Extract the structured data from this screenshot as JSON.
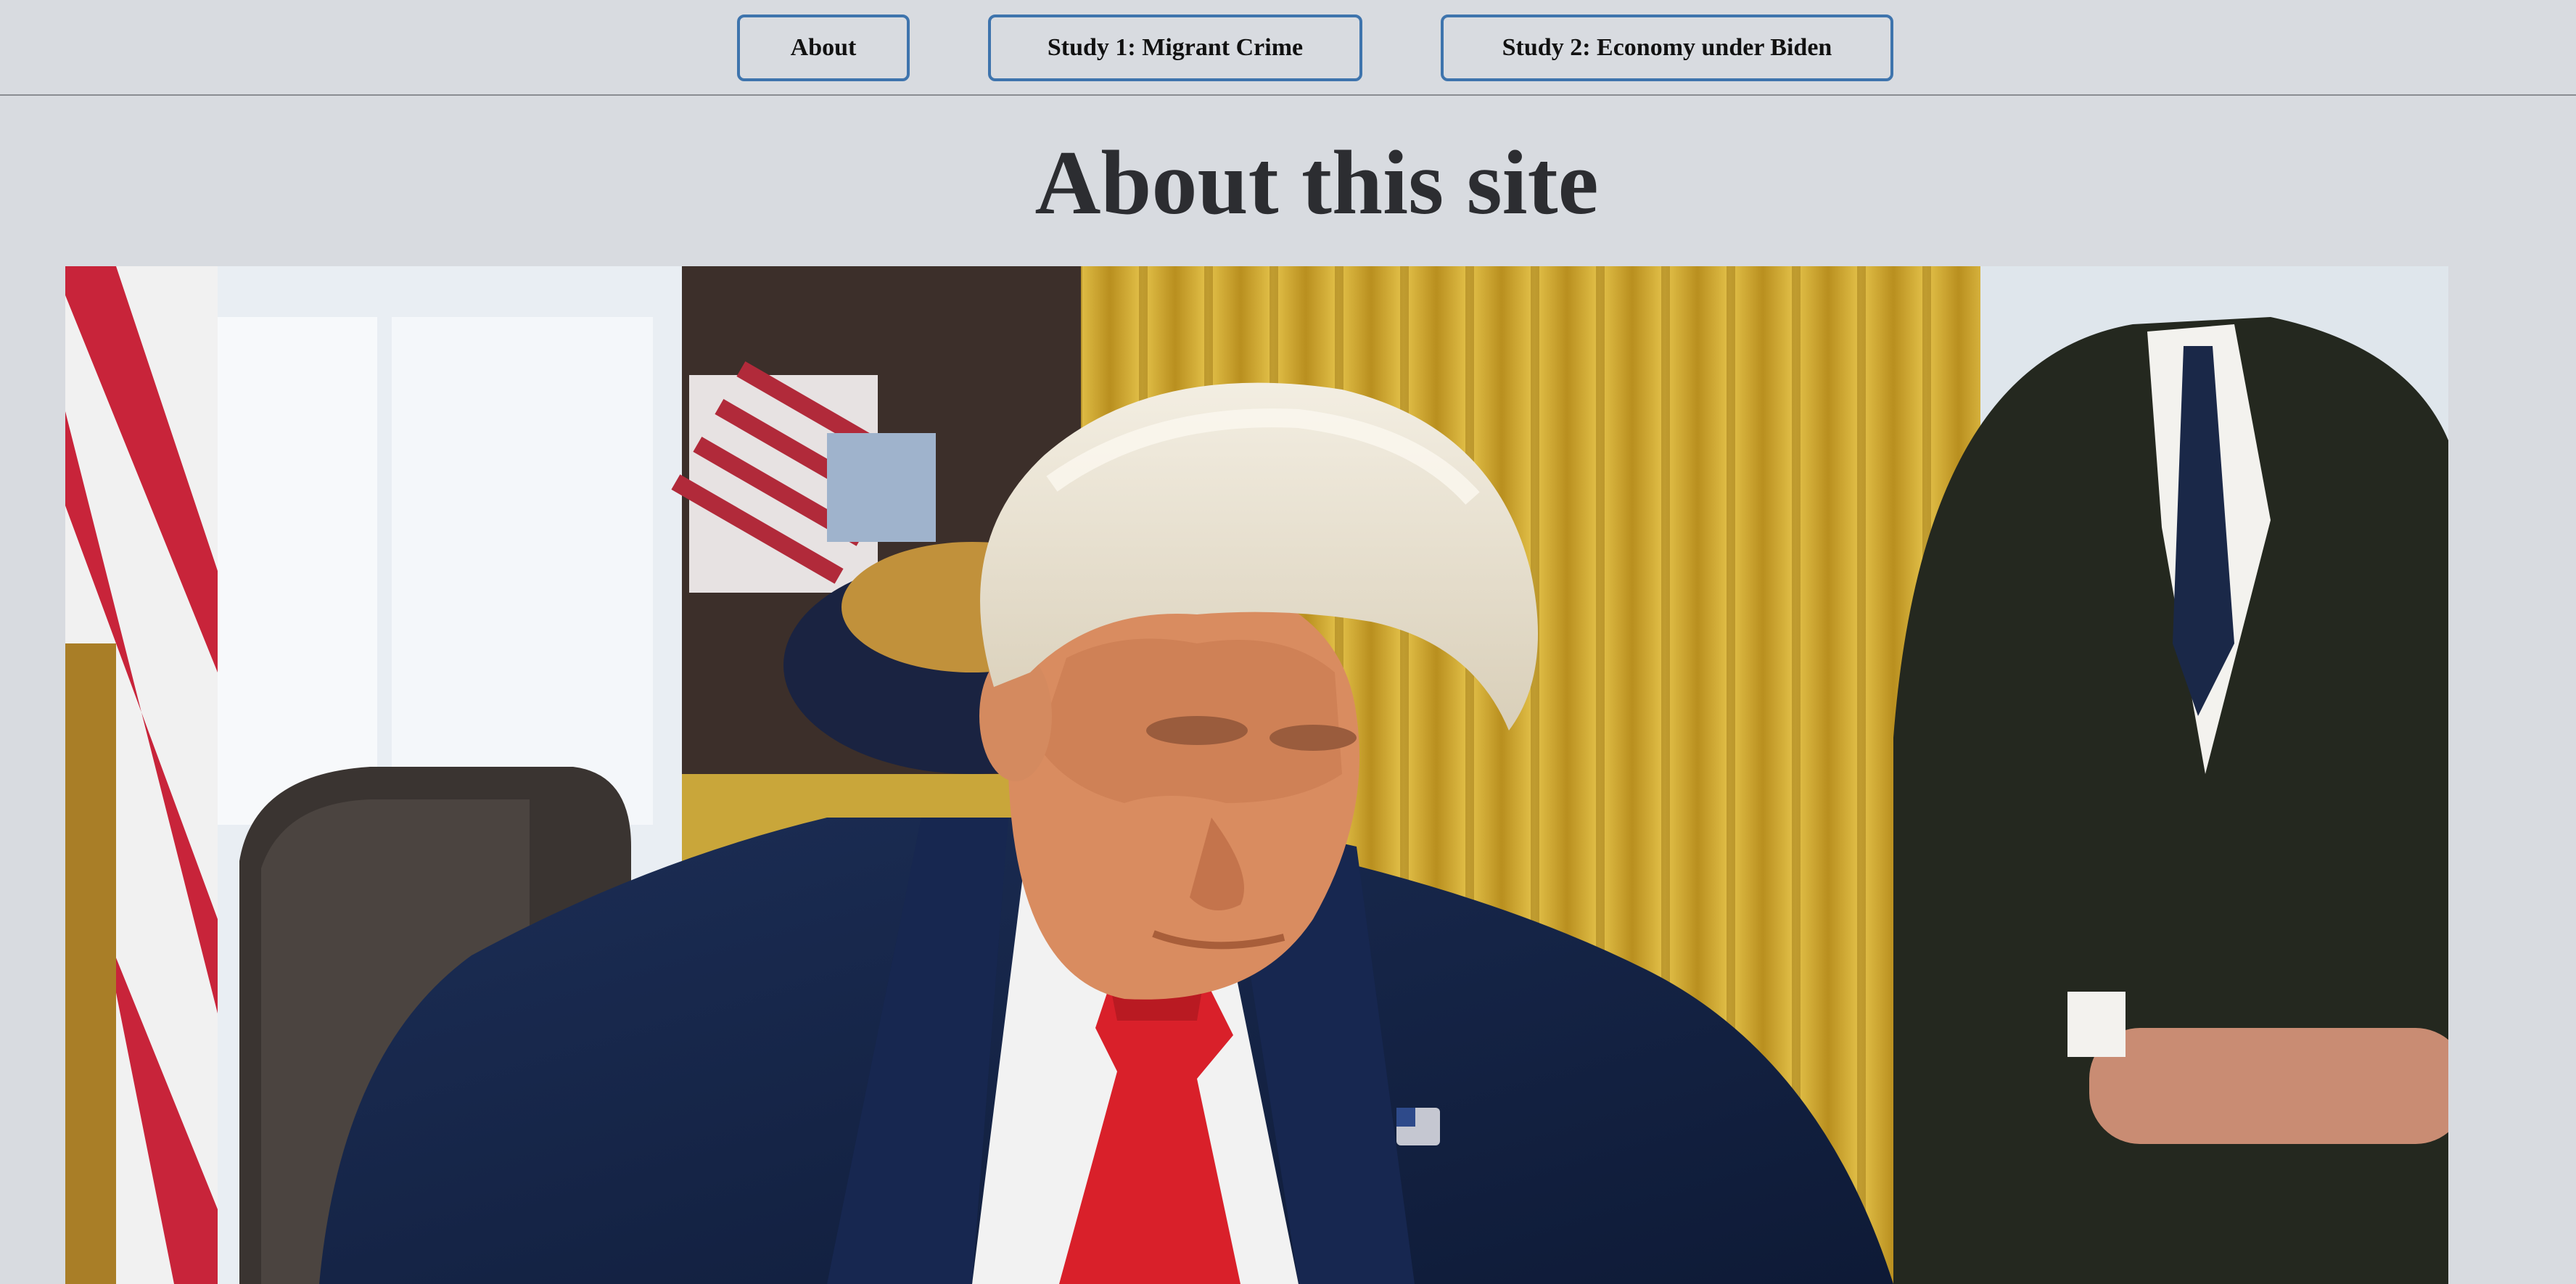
{
  "nav": {
    "about_label": "About",
    "study1_label": "Study 1: Migrant Crime",
    "study2_label": "Study 2: Economy under Biden",
    "border_color": "#3e74ad"
  },
  "page": {
    "title": "About this site",
    "background_color": "#d8dbe0"
  },
  "photo": {
    "alt": "Trump-Vance-US-President-Trump-Signing-1536x1024"
  }
}
